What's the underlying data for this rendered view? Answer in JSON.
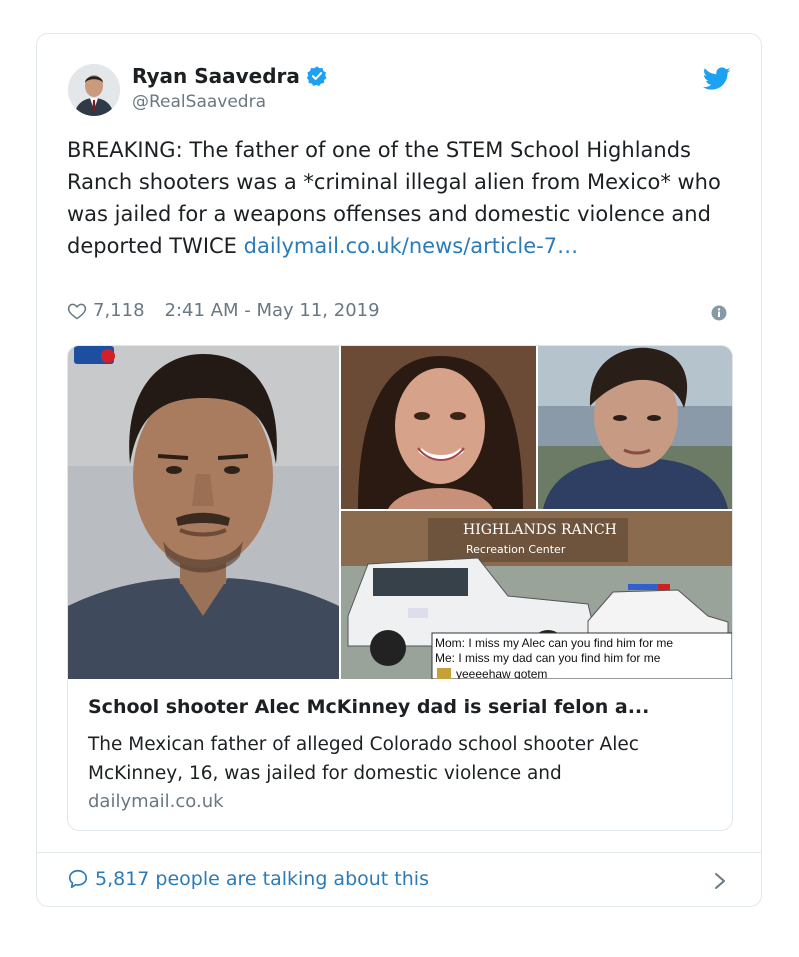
{
  "tweet": {
    "author": {
      "display_name": "Ryan Saavedra",
      "handle": "@RealSaavedra",
      "verified": true
    },
    "text": "BREAKING: The father of one of the STEM School Highlands Ranch shooters was a *criminal illegal alien from Mexico* who was jailed for a weapons offenses and domestic violence and deported TWICE",
    "link_text": "dailymail.co.uk/news/article-7…",
    "likes": "7,118",
    "timestamp": "2:41 AM - May 11, 2019"
  },
  "link_card": {
    "image_sign_line1": "HIGHLANDS RANCH",
    "image_sign_line2": "Recreation Center",
    "image_caption_line1": "Mom: I miss my Alec can you find him for me",
    "image_caption_line2": "Me: I miss my dad can you find him for me",
    "image_caption_line3": "yeeeehaw gotem",
    "title": "School shooter Alec McKinney dad is serial felon a...",
    "description": "The Mexican father of alleged Colorado school shooter Alec McKinney, 16, was jailed for domestic violence and",
    "domain": "dailymail.co.uk"
  },
  "footer": {
    "talking_text": "5,817 people are talking about this"
  },
  "colors": {
    "link": "#2b7bb9",
    "muted": "#697882",
    "border": "#e1e8ed",
    "verified": "#1da1f2"
  },
  "icons": [
    "verified-badge-icon",
    "twitter-bird-icon",
    "heart-icon",
    "info-icon",
    "comment-bubble-icon",
    "chevron-right-icon"
  ]
}
